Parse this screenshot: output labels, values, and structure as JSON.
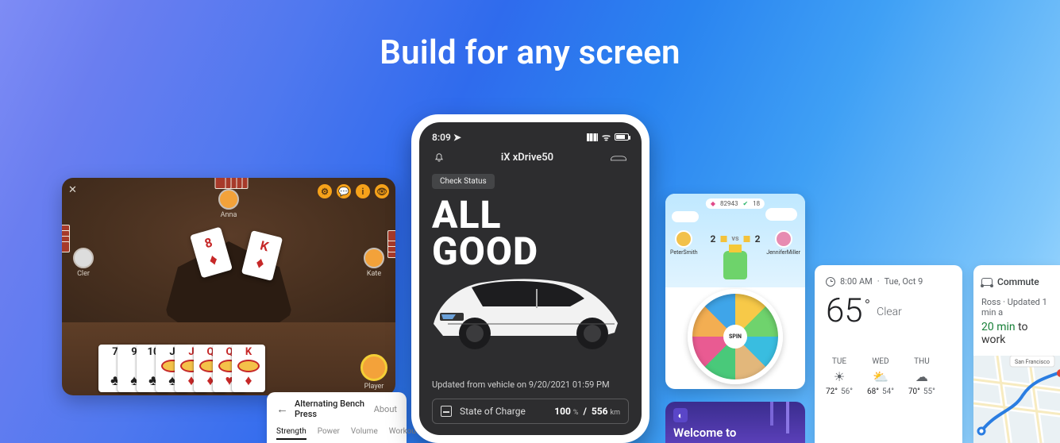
{
  "hero": {
    "title": "Build for any screen"
  },
  "card_game": {
    "players": {
      "top": "Anna",
      "left": "Cler",
      "right": "Kate",
      "self": "Player"
    },
    "center_cards": [
      {
        "rank": "8",
        "suit": "♦"
      },
      {
        "rank": "K",
        "suit": "♦"
      }
    ],
    "hand": [
      {
        "rank": "7",
        "color": "blk",
        "suit": "♣"
      },
      {
        "rank": "9",
        "color": "blk",
        "suit": "♠"
      },
      {
        "rank": "10",
        "color": "blk",
        "suit": "♣"
      },
      {
        "rank": "J",
        "color": "blk",
        "suit": "♠",
        "face": true
      },
      {
        "rank": "J",
        "color": "red",
        "suit": "♦",
        "face": true
      },
      {
        "rank": "Q",
        "color": "red",
        "suit": "♦",
        "face": true
      },
      {
        "rank": "Q",
        "color": "red",
        "suit": "♥",
        "face": true
      },
      {
        "rank": "K",
        "color": "red",
        "suit": "♦",
        "face": true
      }
    ],
    "icons": [
      "gear-icon",
      "chat-icon",
      "info-icon",
      "eye-icon"
    ]
  },
  "fitness": {
    "title": "Alternating Bench Press",
    "about": "About",
    "tabs": [
      "Strength",
      "Power",
      "Volume",
      "Workouts"
    ]
  },
  "phone": {
    "time": "8:09",
    "title": "iX xDrive50",
    "chip": "Check Status",
    "hero_line1": "ALL",
    "hero_line2": "GOOD",
    "updated": "Updated from vehicle on 9/20/2021 01:59 PM",
    "soc_label": "State of Charge",
    "soc_percent": "100",
    "soc_percent_unit": "%",
    "soc_sep": "/",
    "soc_range": "556",
    "soc_range_unit": "km"
  },
  "trivia": {
    "hud_gems": "82943",
    "hud_check": "18",
    "left_name": "PeterSmith",
    "right_name": "JenniferMiller",
    "score_left": "2",
    "score_vs": "vs",
    "score_right": "2",
    "spin": "SPIN"
  },
  "welcome": {
    "text": "Welcome to"
  },
  "weather": {
    "time": "8:00 AM",
    "sep": "·",
    "date": "Tue, Oct 9",
    "temp": "65",
    "cond": "Clear",
    "days": [
      {
        "label": "TUE",
        "icon": "☀",
        "hi": "72°",
        "lo": "56°"
      },
      {
        "label": "WED",
        "icon": "⛅",
        "hi": "68°",
        "lo": "54°"
      },
      {
        "label": "THU",
        "icon": "☁",
        "hi": "70°",
        "lo": "55°"
      }
    ]
  },
  "commute": {
    "head": "Commute",
    "dest": "Ross",
    "sep": "·",
    "updated": "Updated 1 min a",
    "duration": "20 min",
    "tail": "to work"
  }
}
